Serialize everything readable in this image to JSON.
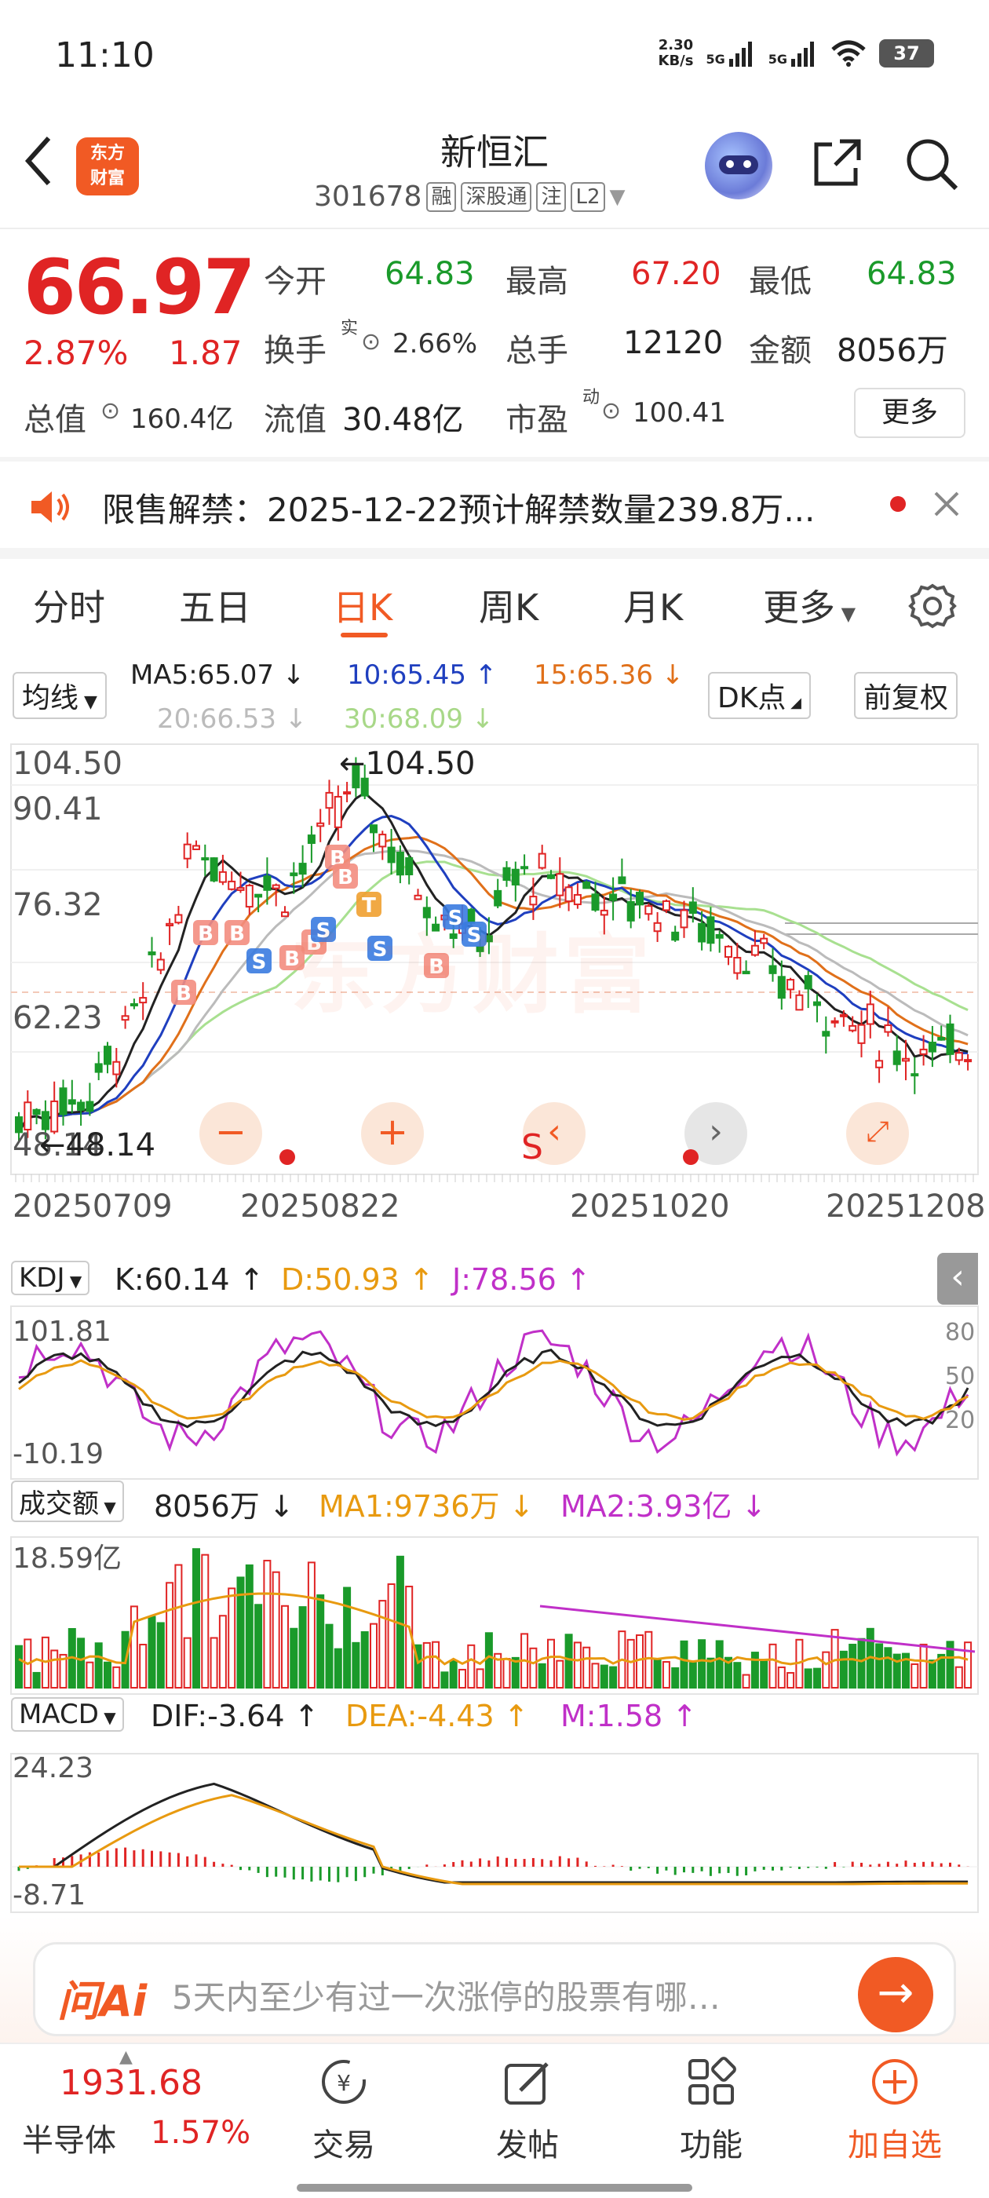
{
  "status_bar": {
    "time": "11:10",
    "net_speed_top": "2.30",
    "net_speed_bottom": "KB/s",
    "sig1": "5G",
    "sig2": "5G",
    "battery": "37"
  },
  "header": {
    "logo_line1": "东方",
    "logo_line2": "财富",
    "name": "新恒汇",
    "code": "301678",
    "tags": [
      "融",
      "深股通",
      "注",
      "L2"
    ]
  },
  "quote": {
    "price": "66.97",
    "change_pct": "2.87%",
    "change": "1.87",
    "open_label": "今开",
    "open": "64.83",
    "high_label": "最高",
    "high": "67.20",
    "low_label": "最低",
    "low": "64.83",
    "turnover_label": "换手",
    "turnover_sup": "实",
    "turnover": "2.66%",
    "volume_label": "总手",
    "volume": "12120",
    "amount_label": "金额",
    "amount": "8056万",
    "mcap_label": "总值",
    "mcap": "160.4亿",
    "float_label": "流值",
    "float": "30.48亿",
    "pe_label": "市盈",
    "pe_sup": "动",
    "pe": "100.41",
    "more_label": "更多"
  },
  "notice": {
    "text": "限售解禁：2025-12-22预计解禁数量239.8万..."
  },
  "tabs": [
    "分时",
    "五日",
    "日K",
    "周K",
    "月K",
    "更多"
  ],
  "active_tab": "日K",
  "kline": {
    "ma_select": "均线",
    "ma5": "MA5:65.07 ↓",
    "ma10": "10:65.45 ↑",
    "ma15": "15:65.36 ↓",
    "ma20": "20:66.53 ↓",
    "ma30": "30:68.09 ↓",
    "dk_label": "DK点",
    "adjust_label": "前复权",
    "y_labels": [
      "104.50",
      "90.41",
      "76.32",
      "62.23",
      "48.14"
    ],
    "high_marker": "←104.50",
    "low_marker": "←48.14",
    "dates": [
      "20250709",
      "20250822",
      "20251020",
      "20251208"
    ],
    "watermark": "东方财富",
    "s_label": "S"
  },
  "kdj": {
    "select": "KDJ",
    "k": "K:60.14 ↑",
    "d": "D:50.93 ↑",
    "j": "J:78.56 ↑",
    "y_top": "101.81",
    "y_bottom": "-10.19",
    "r80": "80",
    "r50": "50",
    "r20": "20"
  },
  "vol": {
    "select": "成交额",
    "value": "8056万 ↓",
    "ma1": "MA1:9736万 ↓",
    "ma2": "MA2:3.93亿 ↓",
    "y_top": "18.59亿"
  },
  "macd": {
    "select": "MACD",
    "dif": "DIF:-3.64 ↑",
    "dea": "DEA:-4.43 ↑",
    "m": "M:1.58 ↑",
    "y_top": "24.23",
    "y_bottom": "-8.71"
  },
  "ai": {
    "logo": "问Ai",
    "placeholder": "5天内至少有过一次涨停的股票有哪…"
  },
  "bottom": {
    "index_value": "1931.68",
    "index_name": "半导体",
    "index_pct": "1.57%",
    "nav": [
      "交易",
      "发帖",
      "功能",
      "加自选"
    ]
  },
  "colors": {
    "up": "#e02424",
    "down": "#1a9a2a",
    "accent": "#f15a24",
    "ma5": "#222222",
    "ma10": "#1f3fbf",
    "ma15": "#e0701a",
    "ma20": "#bbbbbb",
    "ma30": "#a8e090"
  }
}
